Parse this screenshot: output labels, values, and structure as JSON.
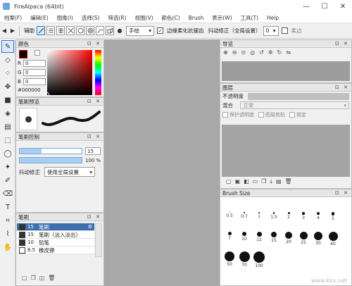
{
  "window": {
    "title": "FireAlpaca (64bit)",
    "controls": [
      "—",
      "☐",
      "✕"
    ]
  },
  "menu": [
    "档案(F)",
    "编辑(E)",
    "图像(I)",
    "选择(S)",
    "筛选(R)",
    "视图(V)",
    "颜色(C)",
    "Brush",
    "表示(W)",
    "工具(T)",
    "Help"
  ],
  "toolbar": {
    "assist_label": "辅助",
    "hand_mode": "手绘",
    "antialias_label": "边缘柔化抗锯齿",
    "stabilizer_label": "抖动修正（全局设置）",
    "stabilizer_value": "0",
    "soft_label": "柔边"
  },
  "color_panel": {
    "title": "颜色",
    "r": "0",
    "g": "0",
    "b": "0",
    "hex": "#000000"
  },
  "brush_preview_panel": {
    "title": "笔刷预览"
  },
  "brush_control": {
    "title": "笔刷控制",
    "size_value": "15",
    "opacity_value": "100",
    "opacity_unit": "%",
    "stab_label": "抖动修正",
    "stab_select": "使用全局设置",
    "size_fraction": 0.35,
    "opacity_fraction": 1.0
  },
  "brush_panel": {
    "title": "笔刷",
    "items": [
      {
        "size": "15",
        "name": "笔刷",
        "selected": true
      },
      {
        "size": "15",
        "name": "笔刷（淡入淡出）",
        "selected": false
      },
      {
        "size": "10",
        "name": "铅笔",
        "selected": false
      },
      {
        "size": "8.5",
        "name": "橡皮擦",
        "selected": false
      }
    ]
  },
  "navigator": {
    "title": "导览"
  },
  "layers": {
    "title": "图层",
    "opacity_label": "不透明度",
    "blend_label": "混合",
    "blend_value": "正常",
    "protect_label": "保护透明度",
    "clip_label": "图层剪贴",
    "lock_label": "锁定"
  },
  "brush_size": {
    "title": "Brush Size",
    "labels": [
      "0.5",
      "0.7",
      "1",
      "1.5",
      "2",
      "3",
      "4",
      "5",
      "7",
      "10",
      "12",
      "15",
      "20",
      "25",
      "30",
      "40",
      "50",
      "70",
      "100"
    ]
  },
  "watermark": "www.kkx.net"
}
